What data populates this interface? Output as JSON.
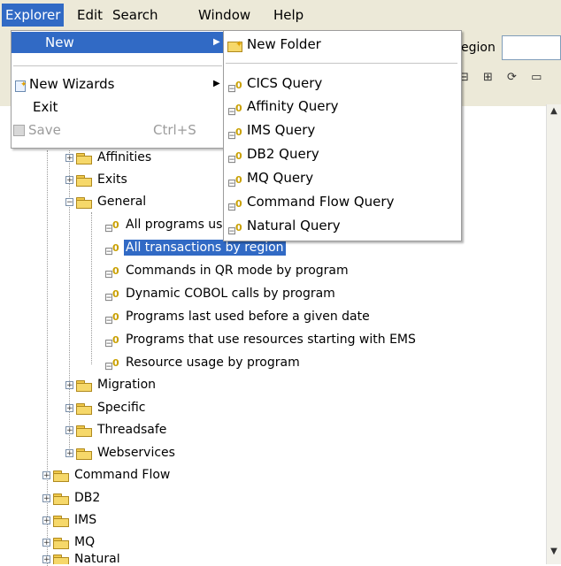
{
  "menubar": {
    "items": [
      "Explorer",
      "Edit",
      "Search",
      "Window",
      "Help"
    ]
  },
  "explorer_menu": {
    "new_label": "New",
    "new_wizards_label": "New Wizards",
    "exit_label": "Exit",
    "save_label": "Save",
    "save_shortcut": "Ctrl+S"
  },
  "new_submenu": {
    "new_folder_label": "New Folder",
    "queries": [
      "CICS Query",
      "Affinity Query",
      "IMS Query",
      "DB2 Query",
      "MQ Query",
      "Command Flow Query",
      "Natural Query"
    ]
  },
  "header": {
    "region_label_partial": "egion"
  },
  "tree": {
    "general_folders_before": [
      "Affinities",
      "Exits",
      "General"
    ],
    "general_queries": [
      "All programs used by transaction",
      "All transactions by region",
      "Commands in QR mode by program",
      "Dynamic COBOL calls by program",
      "Programs last used before a given date",
      "Programs that use resources starting with EMS",
      "Resource usage by program"
    ],
    "general_folders_after": [
      "Migration",
      "Specific",
      "Threadsafe",
      "Webservices"
    ],
    "top_folders": [
      "Command Flow",
      "DB2",
      "IMS",
      "MQ",
      "Natural"
    ]
  }
}
